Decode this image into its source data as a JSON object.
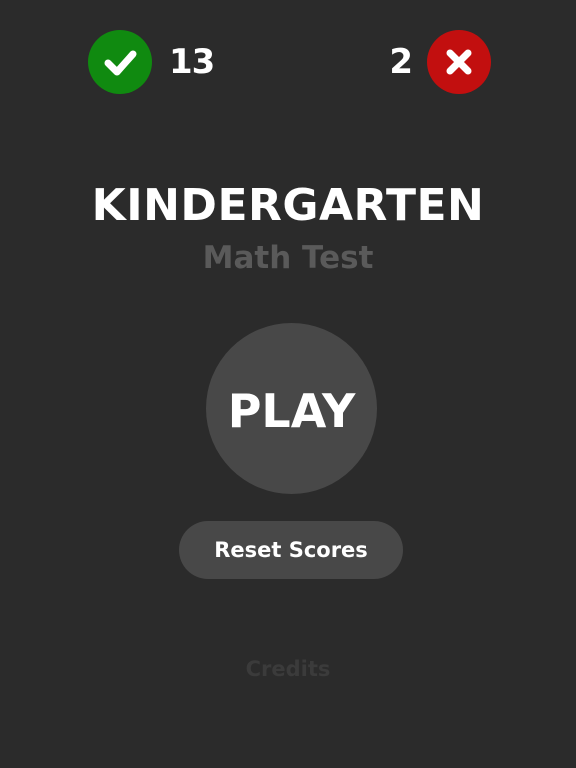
{
  "scores": {
    "correct": {
      "icon": "checkmark-icon",
      "count": "13",
      "color": "#108a10"
    },
    "wrong": {
      "icon": "x-mark-icon",
      "count": "2",
      "color": "#c20f0f"
    }
  },
  "title": "KINDERGARTEN",
  "subtitle": "Math Test",
  "play_label": "PLAY",
  "reset_label": "Reset Scores",
  "credits_label": "Credits",
  "colors": {
    "background": "#2b2b2b",
    "button": "#484848",
    "subtitle": "#5a5a5a",
    "credits": "#3b3b3b",
    "text": "#ffffff"
  }
}
